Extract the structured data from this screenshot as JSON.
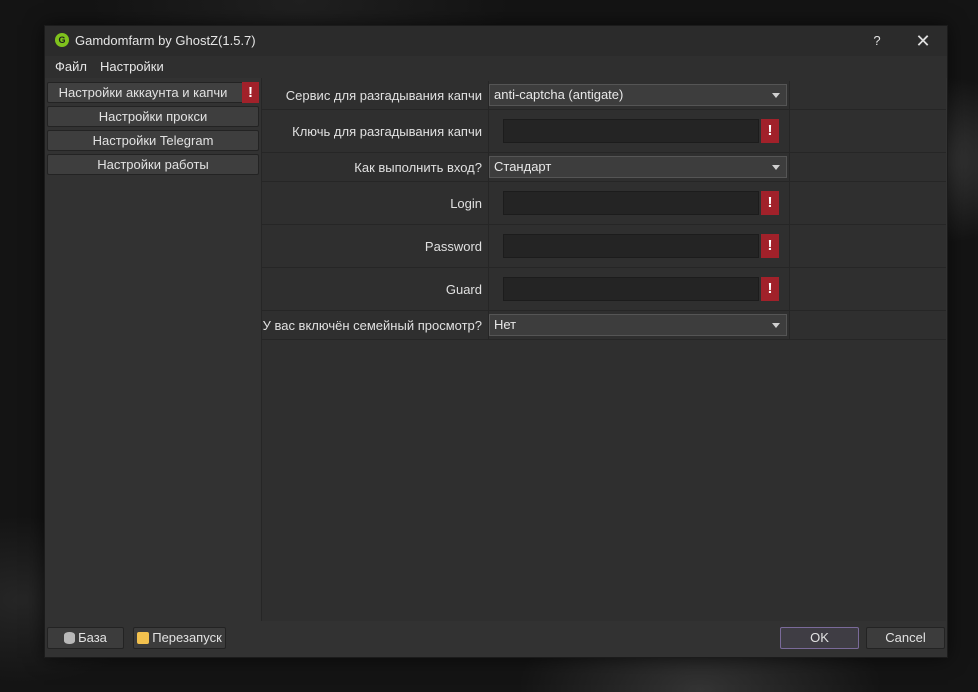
{
  "window": {
    "title": "Gamdomfarm by GhostZ(1.5.7)",
    "help_glyph": "?",
    "close_glyph": "✕"
  },
  "menu": {
    "items": [
      "Файл",
      "Настройки"
    ]
  },
  "sidebar": {
    "items": [
      {
        "label": "Настройки аккаунта и капчи",
        "alert": "!"
      },
      {
        "label": "Настройки прокси"
      },
      {
        "label": "Настройки Telegram"
      },
      {
        "label": "Настройки работы"
      }
    ]
  },
  "form": {
    "captcha_service": {
      "label": "Сервис для разгадывания капчи",
      "value": "anti-captcha (antigate)"
    },
    "captcha_key": {
      "label": "Ключь для разгадывания капчи",
      "value": "",
      "alert": "!"
    },
    "login_method": {
      "label": "Как выполнить вход?",
      "value": "Стандарт"
    },
    "login": {
      "label": "Login",
      "value": "",
      "alert": "!"
    },
    "password": {
      "label": "Password",
      "value": "",
      "alert": "!"
    },
    "guard": {
      "label": "Guard",
      "value": "",
      "alert": "!"
    },
    "family_view": {
      "label": "У вас включён семейный просмотр?",
      "value": "Нет"
    }
  },
  "footer": {
    "base_label": "База",
    "restart_label": "Перезапуск",
    "ok_label": "OK",
    "cancel_label": "Cancel"
  },
  "colors": {
    "alert": "#a1212a",
    "window_bg": "#323232",
    "ok_border": "#7a6a9a"
  }
}
